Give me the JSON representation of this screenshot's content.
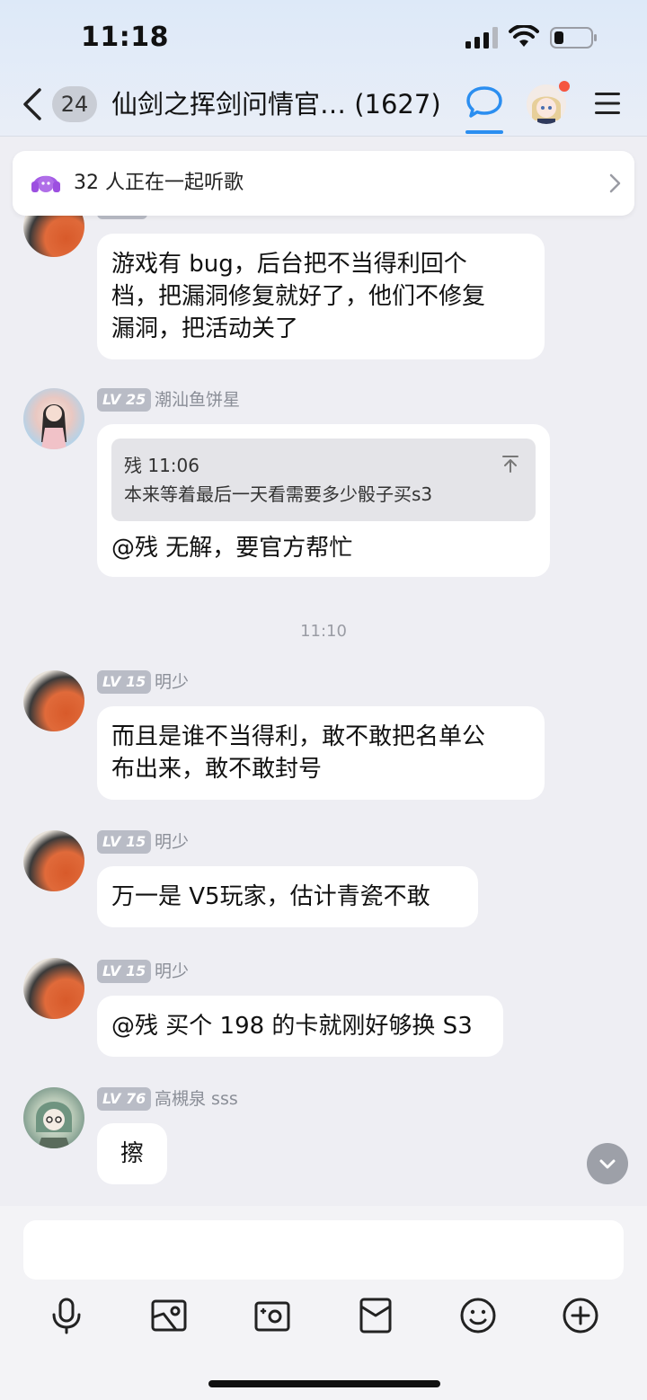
{
  "status": {
    "time": "11:18"
  },
  "header": {
    "unread_count": "24",
    "title": "仙剑之挥剑问情官… (1627)"
  },
  "listen_banner": {
    "text": "32 人正在一起听歌"
  },
  "messages": [
    {
      "text_lines": [
        "游戏有 bug，后台把不当得利回个",
        "档，把漏洞修复就好了，他们不修复",
        "漏洞，把活动关了"
      ]
    },
    {
      "level": "LV 25",
      "nick": "潮汕鱼饼星",
      "quote": {
        "author_time": "残 11:06",
        "text": "本来等着最后一天看需要多少骰子买s3"
      },
      "text": "@残 无解，要官方帮忙"
    },
    {
      "level": "LV 15",
      "nick": "明少",
      "text_lines": [
        "而且是谁不当得利，敢不敢把名单公",
        "布出来，敢不敢封号"
      ]
    },
    {
      "level": "LV 15",
      "nick": "明少",
      "text": "万一是 V5玩家，估计青瓷不敢"
    },
    {
      "level": "LV 15",
      "nick": "明少",
      "text": "@残 买个 198 的卡就刚好够换 S3"
    },
    {
      "level": "LV 76",
      "nick": "高槻泉 sss",
      "text": "擦"
    }
  ],
  "time_separator": "11:10",
  "colors": {
    "accent": "#2b8ef0",
    "badge_red": "#f5553f",
    "bubble_bg": "#ffffff",
    "page_bg": "#eeeef3"
  },
  "toolbar_icons": [
    "microphone-icon",
    "image-icon",
    "camera-icon",
    "red-packet-icon",
    "emoji-icon",
    "plus-icon"
  ]
}
